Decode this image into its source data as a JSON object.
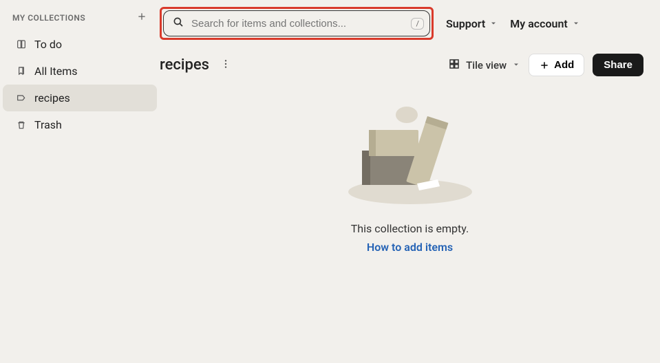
{
  "sidebar": {
    "title": "MY COLLECTIONS",
    "items": [
      {
        "label": "To do"
      },
      {
        "label": "All Items"
      },
      {
        "label": "recipes"
      },
      {
        "label": "Trash"
      }
    ]
  },
  "search": {
    "placeholder": "Search for items and collections...",
    "kbd": "/"
  },
  "topnav": {
    "support": "Support",
    "account": "My account"
  },
  "content": {
    "title": "recipes",
    "view_label": "Tile view",
    "add_label": "Add",
    "share_label": "Share",
    "empty_text": "This collection is empty.",
    "empty_link": "How to add items"
  }
}
